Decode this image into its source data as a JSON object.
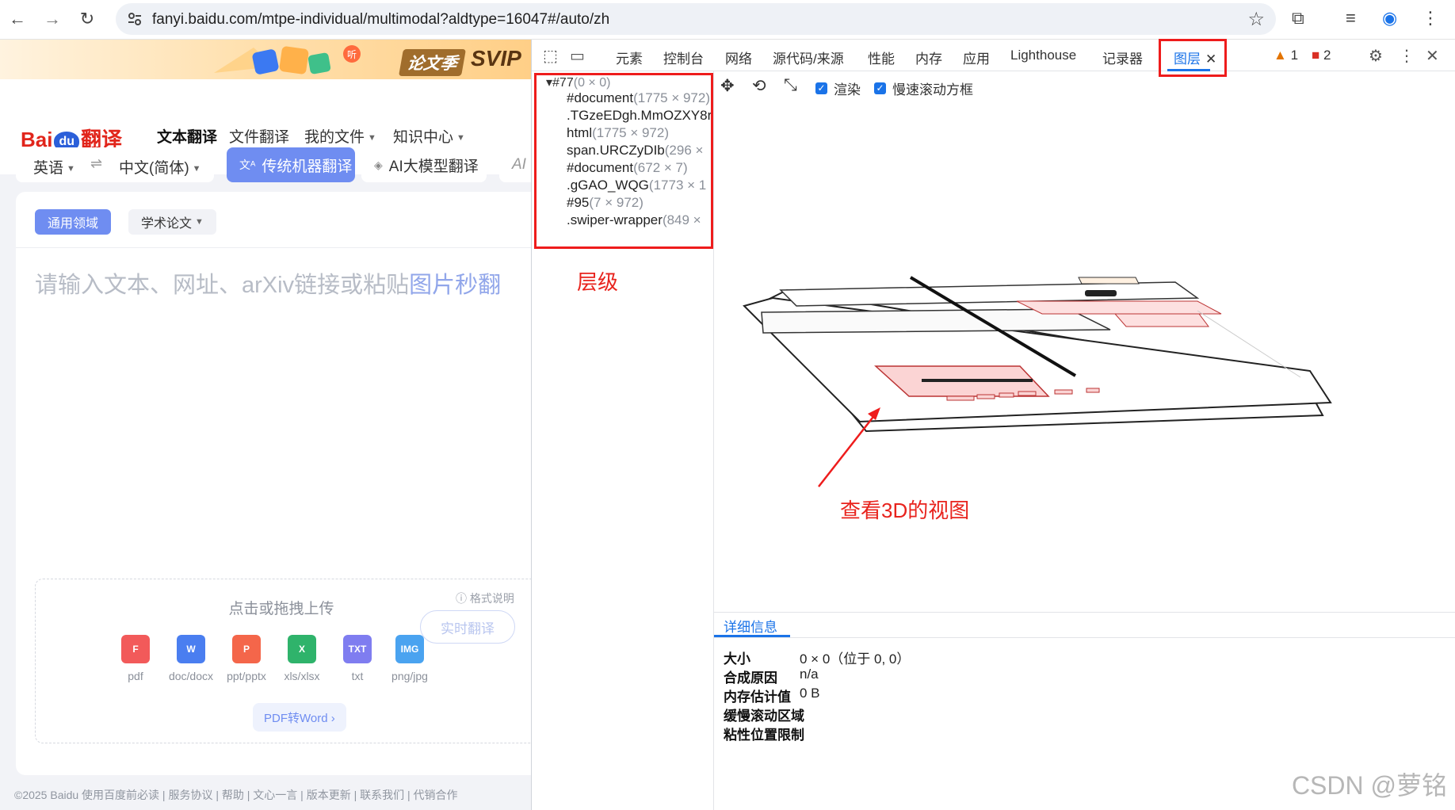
{
  "browser": {
    "url": "fanyi.baidu.com/mtpe-individual/multimodal?aldtype=16047#/auto/zh",
    "icons": [
      "back-icon",
      "forward-icon",
      "reload-icon",
      "tune-icon",
      "star-icon",
      "extensions-icon",
      "media-icon",
      "profile-icon",
      "menu-icon"
    ]
  },
  "baidu": {
    "banner": {
      "tag": "论文季",
      "svip": "SVIP"
    },
    "logo": {
      "text_left": "Bai",
      "text_du": "du",
      "text_right": "翻译"
    },
    "nav": [
      {
        "label": "文本翻译",
        "dropdown": false,
        "active": true
      },
      {
        "label": "文件翻译",
        "dropdown": false,
        "active": false
      },
      {
        "label": "我的文件",
        "dropdown": true,
        "active": false
      },
      {
        "label": "知识中心",
        "dropdown": true,
        "active": false
      }
    ],
    "lang": {
      "source": "英语",
      "swap": "⇌",
      "target": "中文(简体)"
    },
    "modes": {
      "primary": "传统机器翻译",
      "ai": "AI大模型翻译",
      "more": "AI"
    },
    "domains": {
      "general": "通用领域",
      "academic": "学术论文"
    },
    "placeholder": {
      "text": "请输入文本、网址、arXiv链接或粘贴",
      "link": "图片秒翻"
    },
    "upload": {
      "title": "点击或拖拽上传",
      "help": "格式说明",
      "file_types": [
        {
          "label": "pdf",
          "badge": "F",
          "color": "#f25a5a"
        },
        {
          "label": "doc/docx",
          "badge": "W",
          "color": "#4a7ef0"
        },
        {
          "label": "ppt/pptx",
          "badge": "P",
          "color": "#f4664a"
        },
        {
          "label": "xls/xlsx",
          "badge": "X",
          "color": "#2fb36b"
        },
        {
          "label": "txt",
          "badge": "TXT",
          "color": "#7f7df0"
        },
        {
          "label": "png/jpg",
          "badge": "IMG",
          "color": "#4aa3f0"
        }
      ],
      "pdf_to_word": "PDF转Word ›"
    },
    "realtime_button": "实时翻译",
    "footer": "©2025 Baidu   使用百度前必读  |  服务协议  |  帮助  |  文心一言  |  版本更新  |  联系我们  |  代销合作"
  },
  "devtools": {
    "tabs": [
      "元素",
      "控制台",
      "网络",
      "源代码/来源",
      "性能",
      "内存",
      "应用",
      "Lighthouse",
      "记录器",
      "图层"
    ],
    "active_tab": "图层",
    "warnings": "1",
    "errors": "2",
    "layers_tree": {
      "root": {
        "name": "#77",
        "dims": "(0 × 0)"
      },
      "items": [
        {
          "name": "#document",
          "dims": "(1775 × 972)"
        },
        {
          "name": ".TGzeEDgh.MmOZXY8r",
          "dims": ""
        },
        {
          "name": "html",
          "dims": "(1775 × 972)"
        },
        {
          "name": "span.URCZyDIb",
          "dims": "(296 ×"
        },
        {
          "name": "#document",
          "dims": "(672 × 7)"
        },
        {
          "name": ".gGAO_WQG",
          "dims": "(1773 × 1"
        },
        {
          "name": "#95",
          "dims": "(7 × 972)"
        },
        {
          "name": ".swiper-wrapper",
          "dims": "(849 ×"
        }
      ]
    },
    "viewer_options": {
      "render": "渲染",
      "slow_scroll": "慢速滚动方框"
    },
    "details": {
      "tab": "详细信息",
      "rows": [
        {
          "key": "大小",
          "value": "0 × 0（位于 0, 0）"
        },
        {
          "key": "合成原因",
          "value": "n/a"
        },
        {
          "key": "内存估计值",
          "value": "0 B"
        },
        {
          "key": "缓慢滚动区域",
          "value": ""
        },
        {
          "key": "粘性位置限制",
          "value": ""
        }
      ]
    }
  },
  "annotations": {
    "layers_label": "层级",
    "view3d_label": "查看3D的视图",
    "color": "#ee1c1c"
  },
  "watermark": "CSDN @萝铭"
}
